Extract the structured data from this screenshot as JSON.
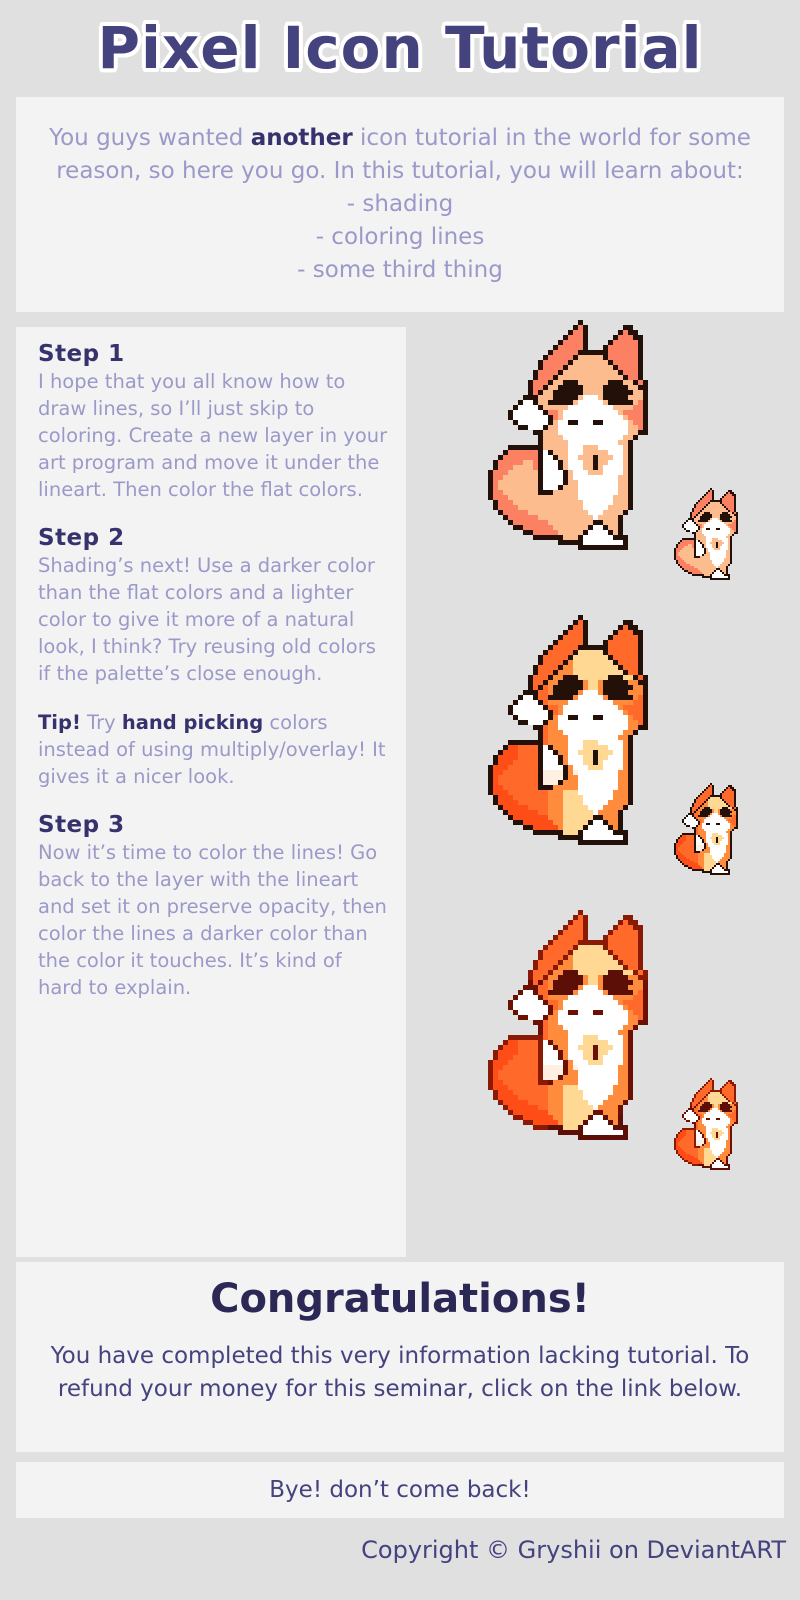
{
  "header": {
    "title": "Pixel Icon Tutorial",
    "title_color": "#45437e",
    "outline_color": "#ffffff"
  },
  "intro": {
    "line1_a": "You guys wanted ",
    "line1_bold": "another",
    "line1_b": " icon tutorial in the world for some reason, so here you go. In this tutorial, you will learn about:",
    "bullets": [
      "- shading",
      "- coloring lines",
      "- some third thing"
    ]
  },
  "steps": [
    {
      "heading": "Step 1",
      "body": "I hope that you all know how to draw lines, so I’ll just skip to coloring. Create a new layer in your art program and move it under the lineart. Then color the flat colors."
    },
    {
      "heading": "Step 2",
      "body": "Shading’s next! Use a darker color than the flat colors and a lighter color to give it more of a natural look, I think? Try reusing old colors if the palette’s close enough."
    },
    {
      "heading": "Step 3",
      "body": "Now it’s time to color the lines! Go back to the layer with the lineart and set it on preserve opacity, then color the lines a darker color than the color it touches. It’s kind of hard to explain."
    }
  ],
  "tip": {
    "label": "Tip!",
    "text_a": " Try ",
    "bold": "hand picking",
    "text_b": " colors instead of using multiply/overlay! It gives it a nicer look."
  },
  "congrats": {
    "title": "Congratulations!",
    "body": "You have completed this very information lacking tutorial. To refund your money for this seminar, click on the link below."
  },
  "bye": {
    "text": "Bye! don’t come back!"
  },
  "copyright": {
    "text": "Copyright © Gryshii on DeviantART"
  },
  "palette": {
    "page_bg": "#e0e0e1",
    "panel_bg": "#f3f3f4",
    "heading": "#35326d",
    "body_text": "#9a99c8",
    "footer_text": "#45437e",
    "line_black": "#231109",
    "coral": "#fc8163",
    "peach": "#fcbc8d",
    "white": "#ffffff",
    "deep_orange": "#ff4d18",
    "orange": "#ff8b3d",
    "light_yellow": "#ffd993",
    "cream": "#fff0e2",
    "line_dark_red": "#6b1003",
    "line_red": "#d2150b"
  },
  "artwork": [
    {
      "name": "fox-flat-large",
      "stage": "flat colors",
      "scale": 5
    },
    {
      "name": "fox-flat-small",
      "stage": "flat colors",
      "scale": 2
    },
    {
      "name": "fox-shaded-large",
      "stage": "shaded",
      "scale": 5
    },
    {
      "name": "fox-shaded-small",
      "stage": "shaded",
      "scale": 2
    },
    {
      "name": "fox-colored-lines-large",
      "stage": "colored lineart",
      "scale": 5
    },
    {
      "name": "fox-colored-lines-small",
      "stage": "colored lineart",
      "scale": 2
    }
  ]
}
